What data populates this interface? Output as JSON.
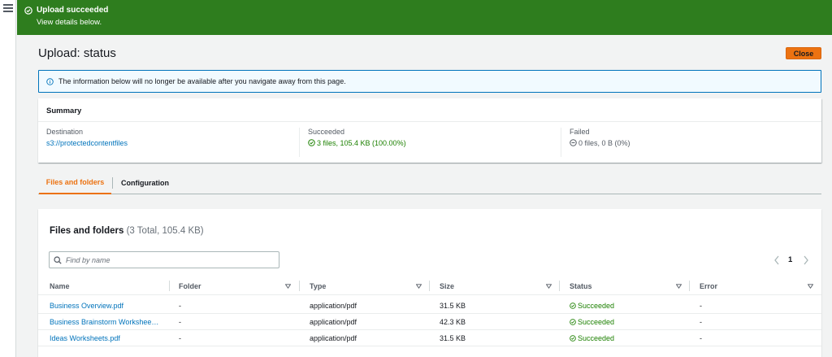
{
  "flash": {
    "title": "Upload succeeded",
    "subtitle": "View details below.",
    "icon": "check-circle-icon",
    "color": "#2e7d1e"
  },
  "page": {
    "title": "Upload: status",
    "close_label": "Close",
    "accent_color": "#ec7211"
  },
  "info": {
    "icon": "info-icon",
    "text": "The information below will no longer be available after you navigate away from this page."
  },
  "summary": {
    "title": "Summary",
    "destination_label": "Destination",
    "destination_value": "s3://protectedcontentfiles",
    "succeeded_label": "Succeeded",
    "succeeded_value": "3 files, 105.4 KB (100.00%)",
    "failed_label": "Failed",
    "failed_value": "0 files, 0 B (0%)"
  },
  "tabs": [
    {
      "label": "Files and folders",
      "active": true
    },
    {
      "label": "Configuration",
      "active": false
    }
  ],
  "files": {
    "title": "Files and folders",
    "count": "(3 Total, 105.4 KB)",
    "search_placeholder": "Find by name",
    "current_page": "1",
    "columns": [
      "Name",
      "Folder",
      "Type",
      "Size",
      "Status",
      "Error"
    ],
    "rows": [
      {
        "name": "Business Overview.pdf",
        "folder": "-",
        "type": "application/pdf",
        "size": "31.5 KB",
        "status": "Succeeded",
        "error": "-"
      },
      {
        "name": "Business Brainstorm Worksheets.pdf",
        "folder": "-",
        "type": "application/pdf",
        "size": "42.3 KB",
        "status": "Succeeded",
        "error": "-"
      },
      {
        "name": "Ideas Worksheets.pdf",
        "folder": "-",
        "type": "application/pdf",
        "size": "31.5 KB",
        "status": "Succeeded",
        "error": "-"
      }
    ]
  }
}
